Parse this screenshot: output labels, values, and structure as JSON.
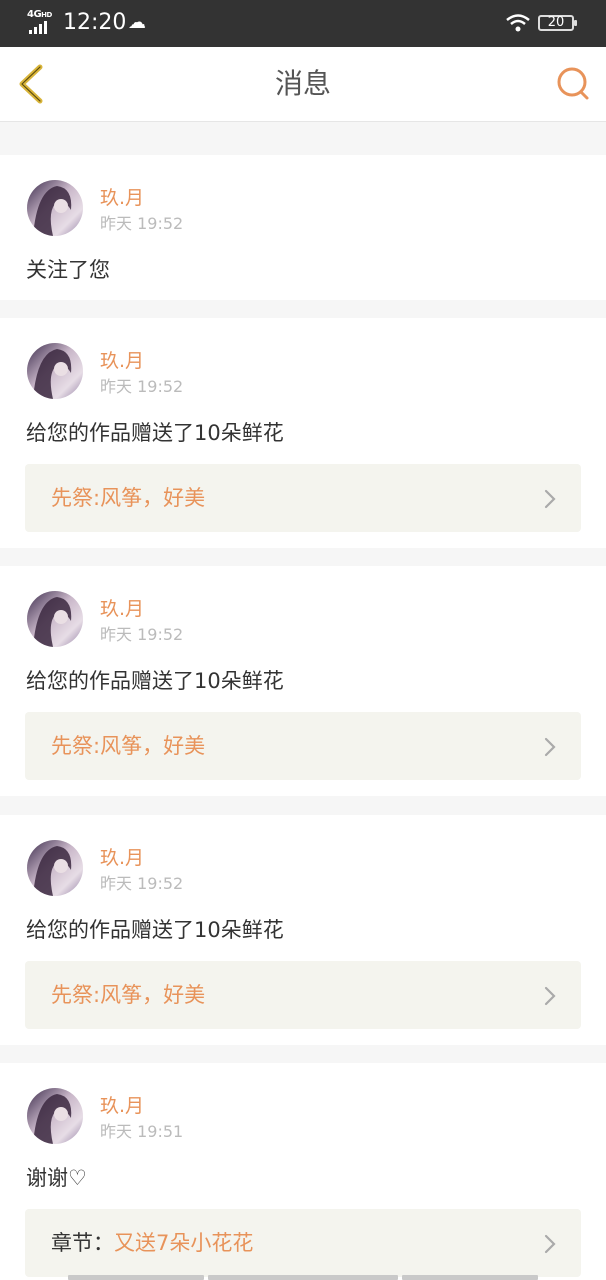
{
  "status_bar": {
    "network": "4G",
    "network_sub": "HD",
    "time": "12:20",
    "battery": "20"
  },
  "header": {
    "title": "消息"
  },
  "messages": [
    {
      "user": "玖.月",
      "time": "昨天 19:52",
      "text": "关注了您"
    },
    {
      "user": "玖.月",
      "time": "昨天 19:52",
      "text": "给您的作品赠送了10朵鲜花",
      "ref": "先祭:风筝，好美"
    },
    {
      "user": "玖.月",
      "time": "昨天 19:52",
      "text": "给您的作品赠送了10朵鲜花",
      "ref": "先祭:风筝，好美"
    },
    {
      "user": "玖.月",
      "time": "昨天 19:52",
      "text": "给您的作品赠送了10朵鲜花",
      "ref": "先祭:风筝，好美"
    },
    {
      "user": "玖.月",
      "time": "昨天 19:51",
      "text": "谢谢♡",
      "ref_prefix": "章节：",
      "ref": "又送7朵小花花"
    }
  ],
  "colors": {
    "accent": "#e8935a",
    "back_icon": "#d9b53a",
    "status_bar_bg": "#333333"
  },
  "icons": {
    "back": "chevron-left-icon",
    "search": "search-icon",
    "ref_chevron": "chevron-right-icon"
  }
}
